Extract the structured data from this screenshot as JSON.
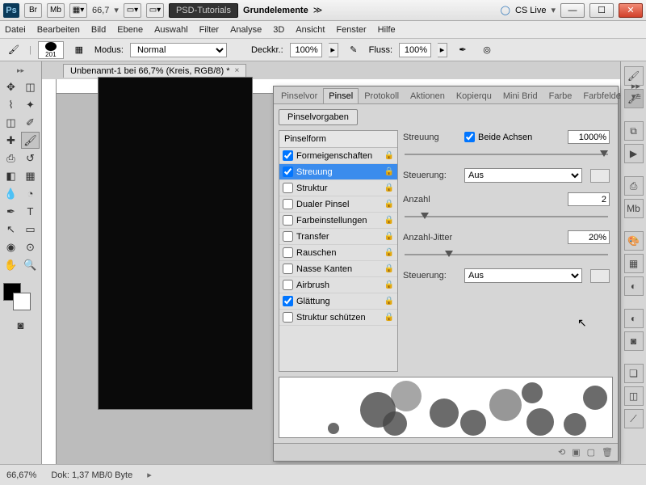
{
  "titlebar": {
    "ps": "Ps",
    "br": "Br",
    "mb": "Mb",
    "zoom": "66,7",
    "psd_tutorials": "PSD-Tutorials",
    "workspace": "Grundelemente",
    "cslive": "CS Live"
  },
  "menu": {
    "datei": "Datei",
    "bearbeiten": "Bearbeiten",
    "bild": "Bild",
    "ebene": "Ebene",
    "auswahl": "Auswahl",
    "filter": "Filter",
    "analyse": "Analyse",
    "d3": "3D",
    "ansicht": "Ansicht",
    "fenster": "Fenster",
    "hilfe": "Hilfe"
  },
  "options": {
    "brush_size": "201",
    "modus_label": "Modus:",
    "modus_value": "Normal",
    "deckkr_label": "Deckkr.:",
    "deckkr_value": "100%",
    "fluss_label": "Fluss:",
    "fluss_value": "100%"
  },
  "document": {
    "tab": "Unbenannt-1 bei 66,7% (Kreis, RGB/8) *"
  },
  "panel": {
    "tabs": {
      "pinselvor": "Pinselvor",
      "pinsel": "Pinsel",
      "protokoll": "Protokoll",
      "aktionen": "Aktionen",
      "kopierqu": "Kopierqu",
      "mini": "Mini Brid",
      "farbe": "Farbe",
      "farbfelde": "Farbfelde"
    },
    "vorgaben_btn": "Pinselvorgaben",
    "pinselform_hdr": "Pinselform",
    "items": [
      {
        "label": "Formeigenschaften",
        "checked": true,
        "sel": false
      },
      {
        "label": "Streuung",
        "checked": true,
        "sel": true
      },
      {
        "label": "Struktur",
        "checked": false,
        "sel": false
      },
      {
        "label": "Dualer Pinsel",
        "checked": false,
        "sel": false
      },
      {
        "label": "Farbeinstellungen",
        "checked": false,
        "sel": false
      },
      {
        "label": "Transfer",
        "checked": false,
        "sel": false
      },
      {
        "label": "Rauschen",
        "checked": false,
        "sel": false
      },
      {
        "label": "Nasse Kanten",
        "checked": false,
        "sel": false
      },
      {
        "label": "Airbrush",
        "checked": false,
        "sel": false
      },
      {
        "label": "Glättung",
        "checked": true,
        "sel": false
      },
      {
        "label": "Struktur schützen",
        "checked": false,
        "sel": false
      }
    ],
    "settings": {
      "streuung_label": "Streuung",
      "beide_achsen": "Beide Achsen",
      "streuung_val": "1000%",
      "steuerung_label": "Steuerung:",
      "steuerung_val": "Aus",
      "anzahl_label": "Anzahl",
      "anzahl_val": "2",
      "anzahljitter_label": "Anzahl-Jitter",
      "anzahljitter_val": "20%"
    }
  },
  "status": {
    "zoom": "66,67%",
    "dok": "Dok: 1,37 MB/0 Byte"
  }
}
